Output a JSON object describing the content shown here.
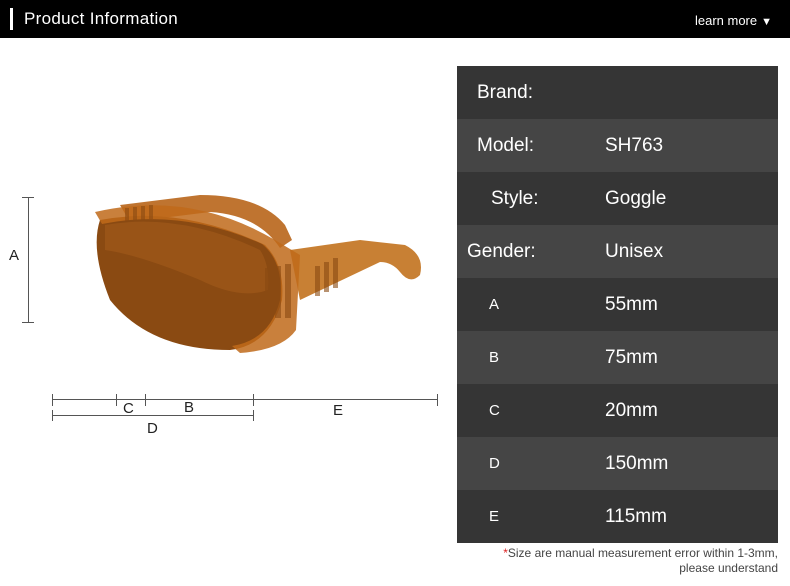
{
  "header": {
    "title": "Product Information",
    "learn_more": "learn more"
  },
  "dimension_labels": {
    "A": "A",
    "B": "B",
    "C": "C",
    "D": "D",
    "E": "E"
  },
  "specs": [
    {
      "key": "Brand:",
      "value": ""
    },
    {
      "key": "Model:",
      "value": "SH763"
    },
    {
      "key": "Style:",
      "value": "Goggle"
    },
    {
      "key": "Gender:",
      "value": "Unisex"
    },
    {
      "key": "A",
      "value": "55mm"
    },
    {
      "key": "B",
      "value": "75mm"
    },
    {
      "key": "C",
      "value": "20mm"
    },
    {
      "key": "D",
      "value": "150mm"
    },
    {
      "key": "E",
      "value": "115mm"
    }
  ],
  "note": {
    "asterisk": "*",
    "line1": "Size are manual measurement error within 1-3mm,",
    "line2": "please understand"
  },
  "colors": {
    "header_bg": "#000000",
    "row_dark": "#353535",
    "row_light": "#454545",
    "lens": "#8a4a12",
    "frame": "#c06a1a"
  }
}
